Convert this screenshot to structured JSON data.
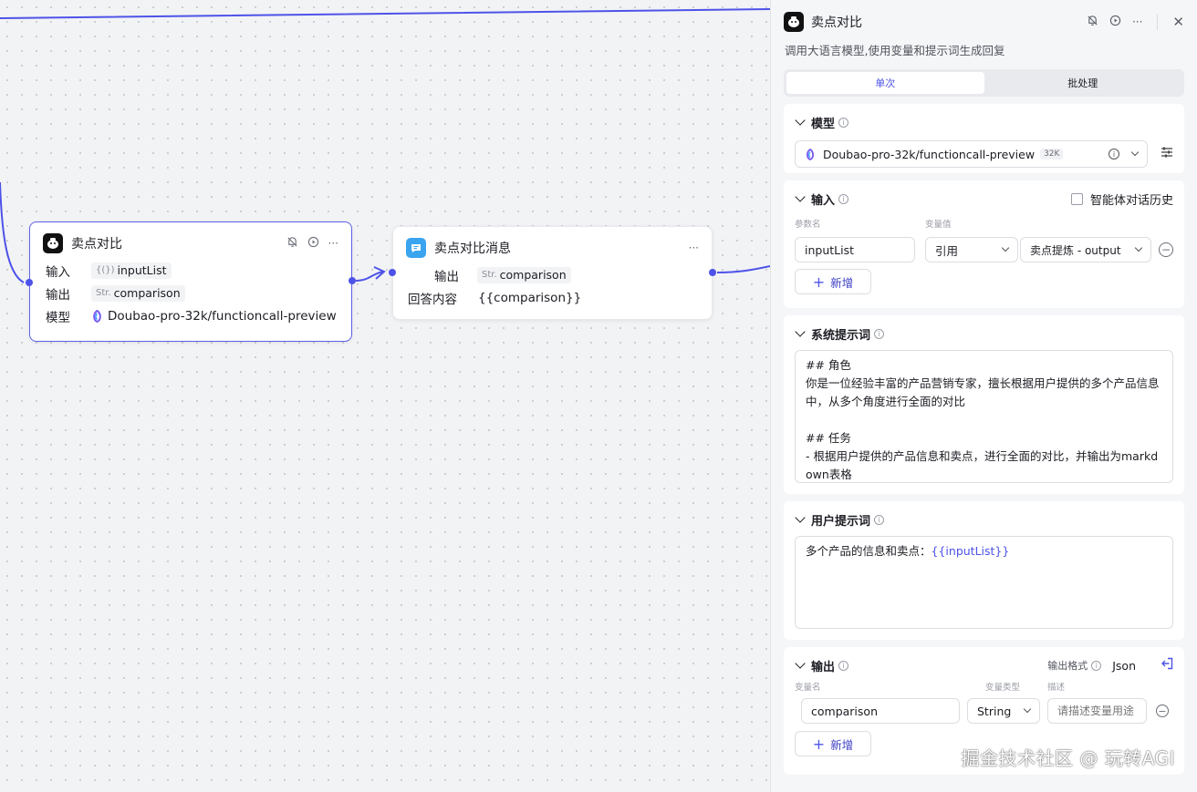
{
  "llm_node": {
    "title": "卖点对比",
    "rows": [
      {
        "label": "输入",
        "prefix": "{(})",
        "value": "inputList"
      },
      {
        "label": "输出",
        "prefix": "Str.",
        "value": "comparison"
      },
      {
        "label": "模型",
        "value": "Doubao-pro-32k/functioncall-preview"
      }
    ]
  },
  "msg_node": {
    "title": "卖点对比消息",
    "output_label": "输出",
    "output_prefix": "Str.",
    "output_value": "comparison",
    "answer_label": "回答内容",
    "answer_value": "{{comparison}}"
  },
  "panel": {
    "title": "卖点对比",
    "description": "调用大语言模型,使用变量和提示词生成回复",
    "tabs": [
      "单次",
      "批处理"
    ],
    "active_tab": 0,
    "model": {
      "heading": "模型",
      "name": "Doubao-pro-32k/functioncall-preview",
      "badge": "32K"
    },
    "input": {
      "heading": "输入",
      "history_label": "智能体对话历史",
      "col_param": "参数名",
      "col_value": "变量值",
      "param_name": "inputList",
      "ref_type": "引用",
      "ref_value": "卖点提炼 - output",
      "add_label": "新增"
    },
    "system_prompt": {
      "heading": "系统提示词",
      "text": "## 角色\n你是一位经验丰富的产品营销专家，擅长根据用户提供的多个产品信息中，从多个角度进行全面的对比\n\n## 任务\n- 根据用户提供的产品信息和卖点，进行全面的对比，并输出为markdown表格"
    },
    "user_prompt": {
      "heading": "用户提示词",
      "prefix_text": "多个产品的信息和卖点：",
      "variable": "{{inputList}}"
    },
    "output": {
      "heading": "输出",
      "format_label": "输出格式",
      "format_value": "Json",
      "col_name": "变量名",
      "col_type": "变量类型",
      "col_desc": "描述",
      "var_name": "comparison",
      "var_type": "String",
      "desc_placeholder": "请描述变量用途",
      "add_label": "新增"
    }
  },
  "watermark": "掘金技术社区 @ 玩转AGI",
  "colors": {
    "accent": "#4d53e8",
    "edge": "#4d53e8",
    "panel_bg": "#f5f6f8"
  }
}
